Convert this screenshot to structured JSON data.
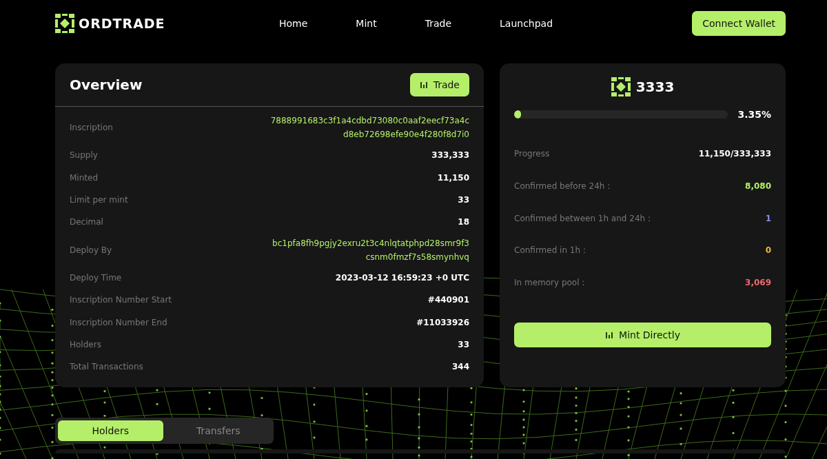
{
  "nav": {
    "brand": "ORDTRADE",
    "links": [
      {
        "label": "Home",
        "selected": false
      },
      {
        "label": "Mint",
        "selected": false
      },
      {
        "label": "Trade",
        "selected": false
      },
      {
        "label": "Launchpad",
        "selected": false
      }
    ],
    "action": "Connect Wallet"
  },
  "overview": {
    "title": "Overview",
    "button": "Trade",
    "rows": [
      {
        "label": "Inscription",
        "value": "7888991683c3f1a4cdbd73080c0aaf2eecf73a4cd8eb72698efe90e4f280f8d7i0",
        "kind": "hash"
      },
      {
        "label": "Supply",
        "value": "333,333",
        "kind": "plain"
      },
      {
        "label": "Minted",
        "value": "11,150",
        "kind": "plain"
      },
      {
        "label": "Limit per mint",
        "value": "33",
        "kind": "plain"
      },
      {
        "label": "Decimal",
        "value": "18",
        "kind": "plain"
      },
      {
        "label": "Deploy By",
        "value": "bc1pfa8fh9pgjy2exru2t3c4nlqtatphpd28smr9f3csnm0fmzf7s58smynhvq",
        "kind": "hash"
      },
      {
        "label": "Deploy Time",
        "value": "2023-03-12 16:59:23 +0 UTC",
        "kind": "plain"
      },
      {
        "label": "Inscription Number Start",
        "value": "#440901",
        "kind": "plain"
      },
      {
        "label": "Inscription Number End",
        "value": "#11033926",
        "kind": "plain"
      },
      {
        "label": "Holders",
        "value": "33",
        "kind": "plain"
      },
      {
        "label": "Total Transactions",
        "value": "344",
        "kind": "plain"
      }
    ]
  },
  "mint": {
    "title": "3333",
    "progress": {
      "level": 0.0335,
      "reading": "3.35%"
    },
    "stats": [
      {
        "label": "Progress",
        "value": "11,150/333,333",
        "color": "#ffffff"
      },
      {
        "label": "Confirmed before 24h :",
        "value": "8,080",
        "color": "#b5ef6a"
      },
      {
        "label": "Confirmed between 1h and 24h :",
        "value": "1",
        "color": "#8a8cf0"
      },
      {
        "label": "Confirmed in 1h :",
        "value": "0",
        "color": "#f5b63a"
      },
      {
        "label": "In memory pool :",
        "value": "3,069",
        "color": "#f06a6a"
      }
    ],
    "button": "Mint Directly"
  },
  "tabs": [
    {
      "label": "Holders",
      "selected": true
    },
    {
      "label": "Transfers",
      "selected": false
    }
  ]
}
